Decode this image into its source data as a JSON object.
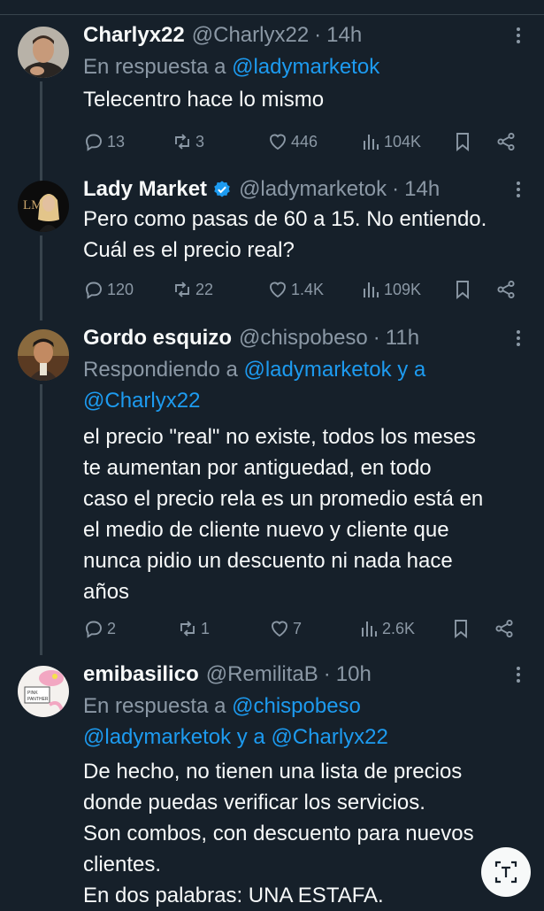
{
  "tweets": [
    {
      "name": "Charlyx22",
      "handle": "@Charlyx22",
      "time": "14h",
      "verified": false,
      "reply_prefix": "En respuesta a",
      "reply_mention": "@ladymarketok",
      "text": "Telecentro hace lo mismo",
      "stats": {
        "replies": "13",
        "retweets": "3",
        "likes": "446",
        "views": "104K"
      }
    },
    {
      "name": "Lady Market",
      "handle": "@ladymarketok",
      "time": "14h",
      "verified": true,
      "text_line1": "Pero como pasas de 60 a 15. No entiendo.",
      "text_line2": "Cuál es el precio real?",
      "stats": {
        "replies": "120",
        "retweets": "22",
        "likes": "1.4K",
        "views": "109K"
      }
    },
    {
      "name": "Gordo esquizo",
      "handle": "@chispobeso",
      "time": "11h",
      "verified": false,
      "reply_prefix": "Respondiendo a",
      "reply_mention1": "@ladymarketok y a",
      "reply_mention2": "@Charlyx22",
      "text_lines": [
        "el precio \"real\" no existe, todos los meses",
        "te aumentan por antiguedad, en todo",
        "caso el precio rela es un promedio está en",
        "el medio de cliente nuevo y cliente que",
        "nunca pidio un descuento ni nada hace",
        "años"
      ],
      "stats": {
        "replies": "2",
        "retweets": "1",
        "likes": "7",
        "views": "2.6K"
      }
    },
    {
      "name": "emibasilico",
      "handle": "@RemilitaB",
      "time": "10h",
      "verified": false,
      "reply_prefix": "En respuesta a",
      "reply_mention1": "@chispobeso",
      "reply_mention2": "@ladymarketok y a @Charlyx22",
      "text_lines": [
        "De hecho, no tienen una lista de precios",
        "donde puedas verificar los servicios.",
        "Son combos, con descuento para  nuevos",
        "clientes.",
        "En dos palabras: UNA ESTAFA."
      ]
    }
  ],
  "separator": "·",
  "colors": {
    "background": "#16202a",
    "muted": "#8b98a5",
    "link": "#1d9bf0",
    "verified": "#1d9bf0"
  }
}
